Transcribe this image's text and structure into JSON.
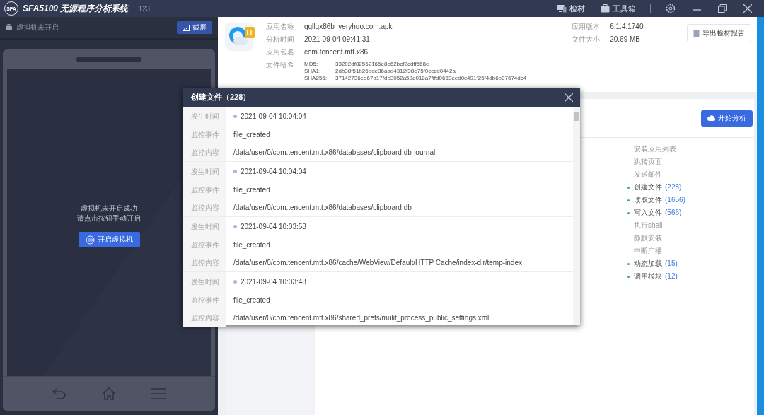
{
  "title_bar": {
    "logo": "SFA",
    "app_name": "SFA5100 无源程序分析系统",
    "version": "123",
    "actions": [
      {
        "label": "检材",
        "kind": "evidence"
      },
      {
        "label": "工具箱",
        "kind": "toolbox"
      }
    ]
  },
  "vm_panel": {
    "status": "虚拟机未开启",
    "screenshot_button": "截屏",
    "message_lines": [
      "虚拟机未开启成功",
      "请点击按钮手动开启"
    ],
    "start_button": "开启虚拟机"
  },
  "app_info": {
    "fields": [
      {
        "label": "应用名称",
        "value": "qqllqx86b_veryhuo.com.apk"
      },
      {
        "label": "分析时间",
        "value": "2021-09-04 09:41:31"
      },
      {
        "label": "应用包名",
        "value": "com.tencent.mtt.x86"
      }
    ],
    "side_fields": [
      {
        "label": "应用版本",
        "value": "6.1.4.1740"
      },
      {
        "label": "文件大小",
        "value": "20.69 MB"
      }
    ],
    "hash_label": "文件哈希",
    "hashes": [
      {
        "name": "MD5:",
        "value": "33202df82562165e8e62bcf2cdff568e"
      },
      {
        "name": "SHA1:",
        "value": "2db38f51b26bde86aad4312f38e75f0cccd0442a"
      },
      {
        "name": "SHA256:",
        "value": "37142736ed67a17fdb3052a58e012a7fffd0653eed0c491f25f4db6b07674dc4"
      }
    ],
    "export_button": "导出检材报告"
  },
  "analysis": {
    "start_button": "开始分析",
    "behaviors": [
      {
        "label": "安装应用列表",
        "detected": false
      },
      {
        "label": "跳转页面",
        "detected": false
      },
      {
        "label": "发送邮件",
        "detected": false
      },
      {
        "label": "创建文件",
        "detected": true,
        "count": "(228)"
      },
      {
        "label": "读取文件",
        "detected": true,
        "count": "(1656)"
      },
      {
        "label": "写入文件",
        "detected": true,
        "count": "(566)"
      },
      {
        "label": "执行shell",
        "detected": false
      },
      {
        "label": "静默安装",
        "detected": false
      },
      {
        "label": "中断广播",
        "detected": false
      },
      {
        "label": "动态加载",
        "detected": true,
        "count": "(15)"
      },
      {
        "label": "调用模块",
        "detected": true,
        "count": "(12)"
      }
    ]
  },
  "dialog": {
    "title": "创建文件（228）",
    "entries": [
      {
        "fields": [
          {
            "label": "发生时间",
            "value": "2021-09-04 10:04:04",
            "kind": "time"
          },
          {
            "label": "监控事件",
            "value": "file_created",
            "kind": "text"
          },
          {
            "label": "监控内容",
            "value": "/data/user/0/com.tencent.mtt.x86/databases/clipboard.db-journal",
            "kind": "text"
          }
        ]
      },
      {
        "fields": [
          {
            "label": "发生时间",
            "value": "2021-09-04 10:04:04",
            "kind": "time"
          },
          {
            "label": "监控事件",
            "value": "file_created",
            "kind": "text"
          },
          {
            "label": "监控内容",
            "value": "/data/user/0/com.tencent.mtt.x86/databases/clipboard.db",
            "kind": "text"
          }
        ]
      },
      {
        "fields": [
          {
            "label": "发生时间",
            "value": "2021-09-04 10:03:58",
            "kind": "time"
          },
          {
            "label": "监控事件",
            "value": "file_created",
            "kind": "text"
          },
          {
            "label": "监控内容",
            "value": "/data/user/0/com.tencent.mtt.x86/cache/WebView/Default/HTTP Cache/index-dir/temp-index",
            "kind": "text"
          }
        ]
      },
      {
        "fields": [
          {
            "label": "发生时间",
            "value": "2021-09-04 10:03:48",
            "kind": "time"
          },
          {
            "label": "监控事件",
            "value": "file_created",
            "kind": "text"
          },
          {
            "label": "监控内容",
            "value": "/data/user/0/com.tencent.mtt.x86/shared_prefs/mulit_process_public_settings.xml",
            "kind": "text"
          }
        ]
      }
    ]
  }
}
